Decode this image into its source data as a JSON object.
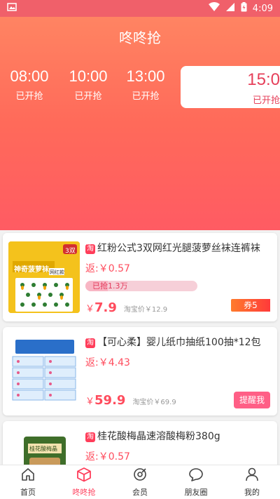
{
  "statusbar": {
    "time": "4:09"
  },
  "header": {
    "title": "咚咚抢"
  },
  "slots": [
    {
      "time": "08:00",
      "status": "已开抢"
    },
    {
      "time": "10:00",
      "status": "已开抢"
    },
    {
      "time": "13:00",
      "status": "已开抢"
    },
    {
      "time": "15:0",
      "status": "已开抢"
    }
  ],
  "products": [
    {
      "badge": "淘",
      "name": "红粉公式3双网红光腿菠萝丝袜连裤袜",
      "rebate": "返:￥0.57",
      "progress_label": "已抢1.3万",
      "progress_fraction": 0.2,
      "currency": "￥",
      "price": "7.9",
      "orig_price": "淘宝价￥12.9",
      "coupon": "券5",
      "thumb_text": "神奇菠萝袜",
      "thumb_tag": "3双",
      "thumb_pack": "网红款"
    },
    {
      "badge": "淘",
      "name": "【可心柔】婴儿纸巾抽纸100抽*12包",
      "rebate": "返:￥4.43",
      "currency": "￥",
      "price": "59.9",
      "orig_price": "淘宝价￥69.9",
      "remind": "提醒我"
    },
    {
      "badge": "淘",
      "name": "桂花酸梅晶速溶酸梅粉380g",
      "rebate": "返:￥0.57",
      "thumb_text": "桂花酸梅晶"
    }
  ],
  "tabs": [
    {
      "label": "首页",
      "icon": "home-icon"
    },
    {
      "label": "咚咚抢",
      "icon": "box-icon"
    },
    {
      "label": "会员",
      "icon": "vip-icon"
    },
    {
      "label": "朋友圈",
      "icon": "chat-icon"
    },
    {
      "label": "我的",
      "icon": "user-icon"
    }
  ],
  "colors": {
    "accent": "#ff3d5a",
    "hero_top": "#ff8462",
    "hero_bottom": "#ff5b63"
  }
}
